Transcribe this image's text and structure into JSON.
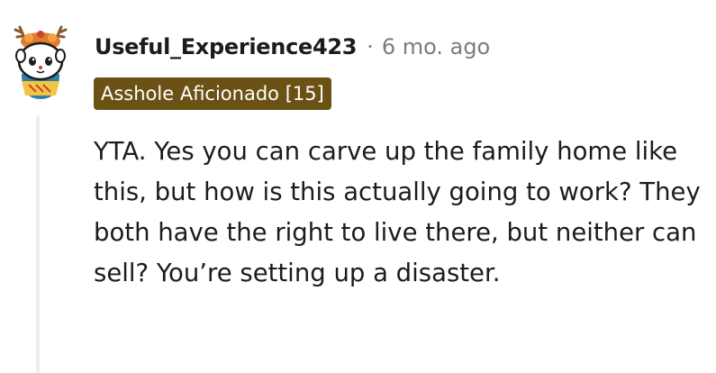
{
  "comment": {
    "author": "Useful_Experience423",
    "separator": "·",
    "age": "6 mo. ago",
    "flair": "Asshole Aficionado [15]",
    "body": "YTA. Yes you can carve up the family home like this, but how is this actually going to work? They both have the right to live there, but neither can sell? You’re setting up a disaster.",
    "avatar_icon": "snoo-avatar-icon"
  },
  "colors": {
    "flair_bg": "#6b5214",
    "flair_text": "#ffffff",
    "meta_text": "#7c7c7c",
    "thread_line": "#ededed"
  }
}
